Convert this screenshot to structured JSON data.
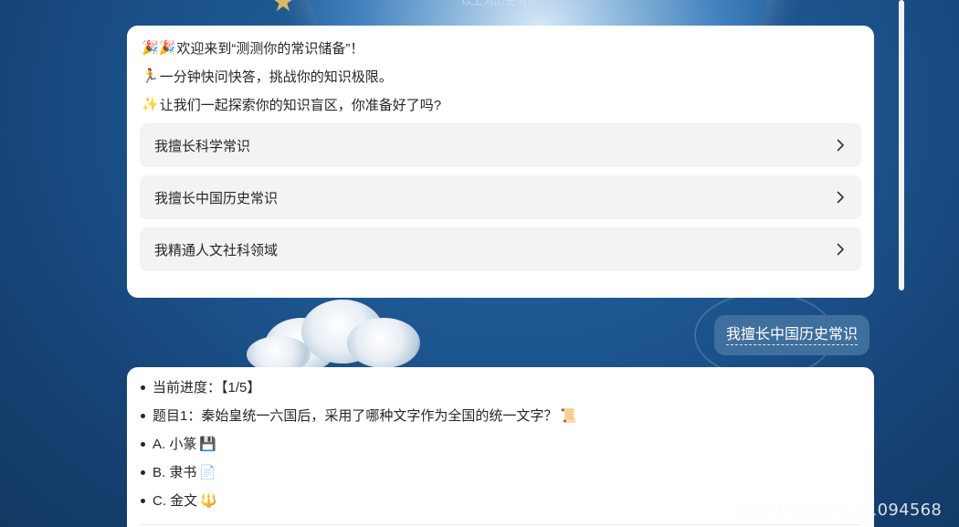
{
  "background": {
    "top_caption": "以上为历史消息"
  },
  "welcome": {
    "lines": [
      {
        "emoji": "🎉🎉",
        "text": "欢迎来到“测测你的常识储备”！"
      },
      {
        "emoji": "🏃",
        "text": "一分钟快问快答，挑战你的知识极限。"
      },
      {
        "emoji": "✨",
        "text": "让我们一起探索你的知识盲区，你准备好了吗?"
      }
    ],
    "options": [
      {
        "label": "我擅长科学常识"
      },
      {
        "label": "我擅长中国历史常识"
      },
      {
        "label": "我精通人文社科领域"
      }
    ]
  },
  "user_message": {
    "text": "我擅长中国历史常识"
  },
  "question": {
    "progress": "当前进度：【1/5】",
    "title": "题目1：秦始皇统一六国后，采用了哪种文字作为全国的统一文字？",
    "title_emoji": "📜",
    "choices": [
      {
        "text": "A. 小篆",
        "emoji": "💾"
      },
      {
        "text": "B. 隶书",
        "emoji": "📄"
      },
      {
        "text": "C. 金文",
        "emoji": "🔱"
      }
    ]
  },
  "watermark": "CSDN @2501_91094568",
  "colors": {
    "background": "#1a4e86",
    "card": "#ffffff",
    "option_bg": "#f3f3f3",
    "user_bubble": "#3f6f9c",
    "text": "#262626"
  }
}
